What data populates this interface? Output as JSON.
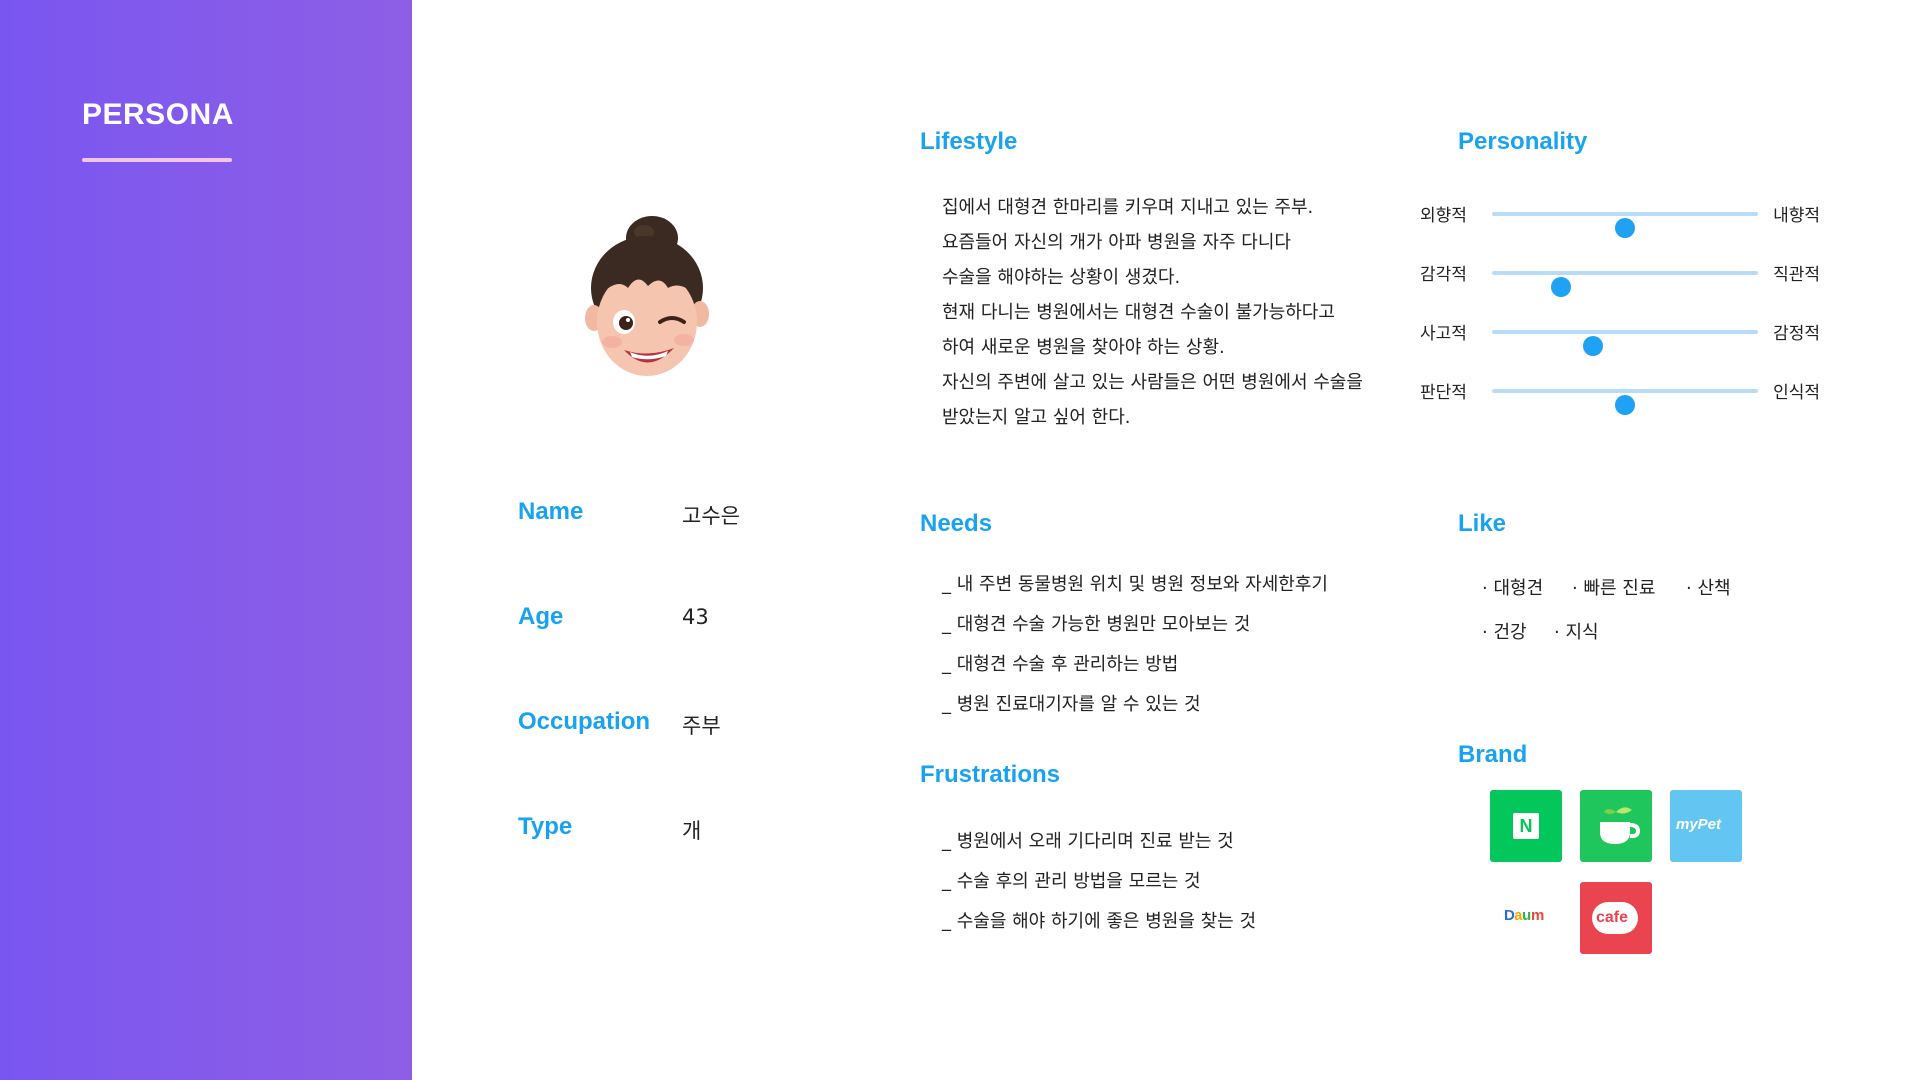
{
  "header": {
    "title": "PERSONA"
  },
  "profile": {
    "name_label": "Name",
    "name_value": "고수은",
    "age_label": "Age",
    "age_value": "43",
    "occupation_label": "Occupation",
    "occupation_value": "주부",
    "type_label": "Type",
    "type_value": "개"
  },
  "lifestyle": {
    "title": "Lifestyle",
    "lines": [
      "집에서 대형견 한마리를 키우며 지내고 있는 주부.",
      "요즘들어 자신의 개가 아파 병원을 자주 다니다",
      "수술을 해야하는 상황이 생겼다.",
      "현재 다니는 병원에서는 대형견 수술이 불가능하다고",
      "하여 새로운 병원을 찾아야 하는 상황.",
      "자신의 주변에 살고 있는 사람들은 어떤 병원에서 수술을",
      "받았는지 알고 싶어 한다."
    ]
  },
  "personality": {
    "title": "Personality",
    "sliders": [
      {
        "left": "외향적",
        "right": "내향적",
        "value": 0.5
      },
      {
        "left": "감각적",
        "right": "직관적",
        "value": 0.26
      },
      {
        "left": "사고적",
        "right": "감정적",
        "value": 0.38
      },
      {
        "left": "판단적",
        "right": "인식적",
        "value": 0.5
      }
    ]
  },
  "needs": {
    "title": "Needs",
    "items": [
      "_ 내 주변 동물병원 위치 및 병원 정보와 자세한후기",
      "_ 대형견 수술 가능한 병원만 모아보는 것",
      "_ 대형견 수술 후 관리하는 방법",
      "_ 병원 진료대기자를 알 수 있는 것"
    ]
  },
  "frustrations": {
    "title": "Frustrations",
    "items": [
      "_ 병원에서 오래 기다리며 진료 받는 것",
      "_ 수술 후의 관리 방법을 모르는 것",
      "_ 수술을 해야 하기에 좋은 병원을 찾는 것"
    ]
  },
  "like": {
    "title": "Like",
    "items": [
      "· 대형견",
      "· 빠른 진료",
      "· 산책",
      "· 건강",
      "· 지식"
    ]
  },
  "brand": {
    "title": "Brand",
    "logos": [
      {
        "name": "naver",
        "text": "N",
        "color": "#03c75a"
      },
      {
        "name": "kakao-cafe-cup",
        "text": "",
        "color": "#1fc65c"
      },
      {
        "name": "mypet",
        "text": "myPet",
        "color": "#63c6f2"
      },
      {
        "name": "daum",
        "text": "Daum",
        "color": "#ffffff"
      },
      {
        "name": "cafe",
        "text": "cafe",
        "color": "#ea4450"
      }
    ]
  }
}
